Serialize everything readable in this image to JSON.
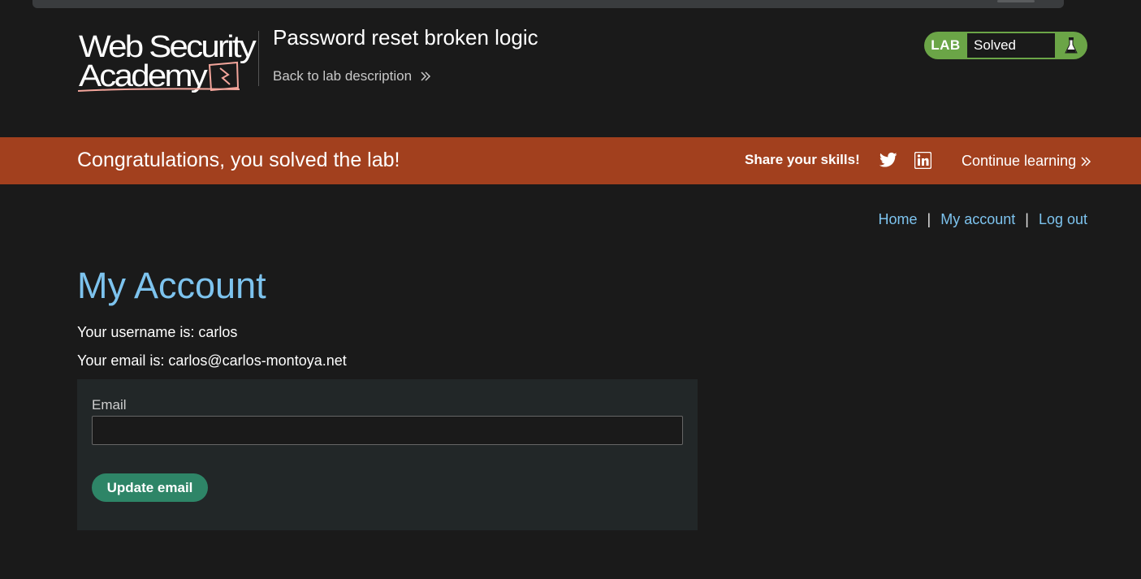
{
  "header": {
    "logo_line1": "Web Security",
    "logo_line2": "Academy",
    "lab_title": "Password reset broken logic",
    "back_link": "Back to lab description"
  },
  "status": {
    "tag": "LAB",
    "value": "Solved",
    "icon": "flask-icon"
  },
  "banner": {
    "message": "Congratulations, you solved the lab!",
    "share_label": "Share your skills!",
    "social_icons": [
      "twitter-icon",
      "linkedin-icon"
    ],
    "continue_label": "Continue learning"
  },
  "nav": {
    "home": "Home",
    "separator": "|",
    "my_account": "My account",
    "log_out": "Log out"
  },
  "account": {
    "heading": "My Account",
    "username_line": "Your username is: carlos",
    "email_line": "Your email is: carlos@carlos-montoya.net"
  },
  "form": {
    "email_label": "Email",
    "email_value": "",
    "submit_label": "Update email"
  },
  "colors": {
    "background": "#1a1a1a",
    "banner": "#a2401e",
    "link": "#7dc3ee",
    "solved_green": "#6ba547",
    "button": "#2e8567",
    "panel": "#222728"
  }
}
